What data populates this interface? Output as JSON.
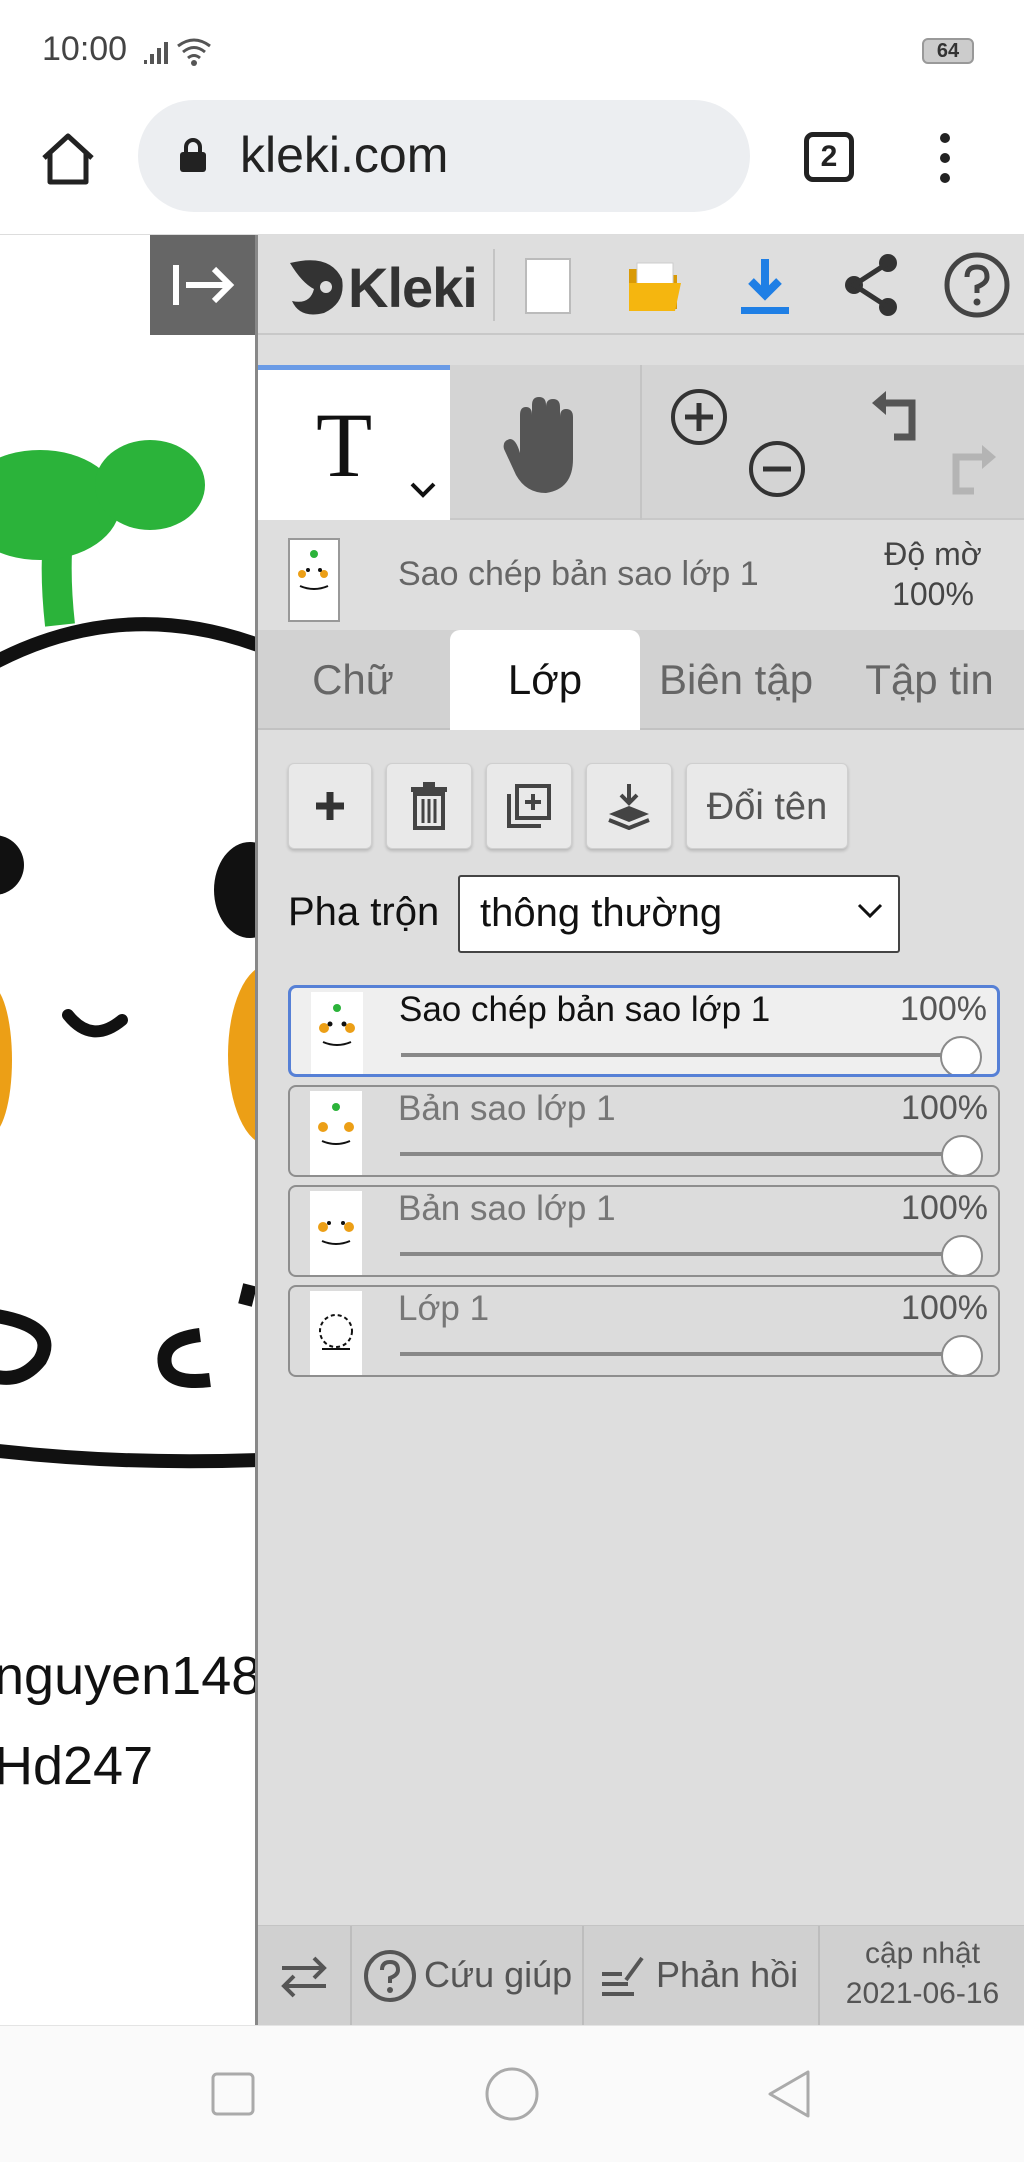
{
  "status_bar": {
    "time": "10:00",
    "battery": "64"
  },
  "browser": {
    "url": "kleki.com",
    "tab_count": "2"
  },
  "canvas": {
    "caption_line1": "nguyen148",
    "caption_line2": "Hd247"
  },
  "header": {
    "logo": "Kleki"
  },
  "tools": {
    "text_tool": "T"
  },
  "layer_info": {
    "name": "Sao chép bản sao lớp 1",
    "opacity_label": "Độ mờ",
    "opacity_value": "100%"
  },
  "tabs": [
    {
      "label": "Chữ"
    },
    {
      "label": "Lớp"
    },
    {
      "label": "Biên tập"
    },
    {
      "label": "Tập tin"
    }
  ],
  "layer_toolbar": {
    "rename": "Đổi tên"
  },
  "blend": {
    "label": "Pha trộn",
    "value": "thông thường"
  },
  "layers": [
    {
      "name": "Sao chép bản sao lớp 1",
      "opacity": "100%",
      "level": 1.0
    },
    {
      "name": "Bản sao lớp 1",
      "opacity": "100%",
      "level": 1.0
    },
    {
      "name": "Bản sao lớp 1",
      "opacity": "100%",
      "level": 1.0
    },
    {
      "name": "Lớp 1",
      "opacity": "100%",
      "level": 1.0
    }
  ],
  "footer": {
    "help": "Cứu giúp",
    "feedback": "Phản hồi",
    "update_label": "cập nhật",
    "update_date": "2021-06-16"
  },
  "colors": {
    "accent": "#5680d6",
    "download": "#1f7fe5",
    "folder": "#f5b60f",
    "sprout": "#2bb33a",
    "cheek": "#ec9f16"
  },
  "icons": [
    "signal-icon",
    "wifi-icon",
    "home-icon",
    "lock-icon",
    "more-icon",
    "collapse-icon",
    "new-file-icon",
    "folder-icon",
    "download-icon",
    "share-icon",
    "help-icon",
    "hand-icon",
    "zoom-in-icon",
    "zoom-out-icon",
    "undo-icon",
    "redo-icon",
    "plus-icon",
    "trash-icon",
    "duplicate-icon",
    "merge-down-icon",
    "chevron-down-icon",
    "swap-icon",
    "feedback-icon",
    "square-icon",
    "circle-icon",
    "back-icon"
  ]
}
